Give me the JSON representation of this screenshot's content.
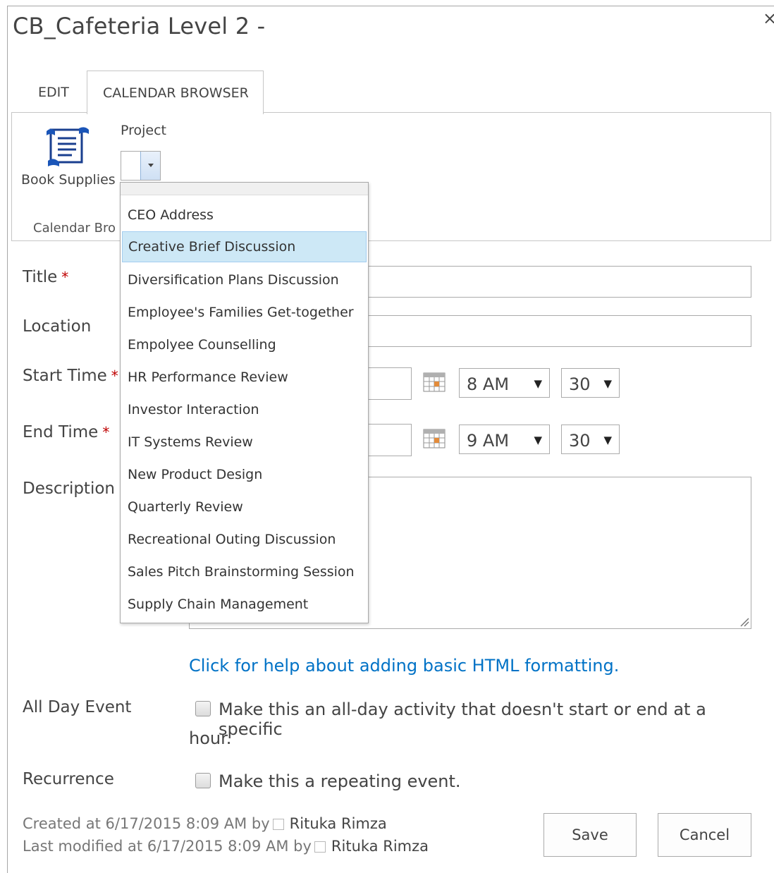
{
  "dialog": {
    "title": "CB_Cafeteria Level 2 -",
    "close_glyph": "×"
  },
  "ribbon": {
    "tabs": [
      {
        "label": "EDIT"
      },
      {
        "label": "CALENDAR BROWSER"
      }
    ],
    "book_supplies_label": "Book Supplies",
    "project_label": "Project",
    "project_value": "",
    "group_label": "Calendar Bro"
  },
  "form": {
    "title_label": "Title",
    "location_label": "Location",
    "start_time_label": "Start Time",
    "end_time_label": "End Time",
    "description_label": "Description",
    "required_marker": "*",
    "start_hour": "8 AM",
    "start_minute": "30",
    "end_hour": "9 AM",
    "end_minute": "30",
    "help_link": "Click for help about adding basic HTML formatting.",
    "all_day_label": "All Day Event",
    "all_day_text_line1": "Make this an all-day activity that doesn't start or end at a specific",
    "all_day_text_line2": "hour.",
    "recurrence_label": "Recurrence",
    "recurrence_text": "Make this a repeating event."
  },
  "footer": {
    "created_prefix": "Created at 6/17/2015 8:09 AM by",
    "created_user": "Rituka Rimza",
    "modified_prefix": "Last modified at 6/17/2015 8:09 AM by",
    "modified_user": "Rituka Rimza",
    "save_label": "Save",
    "cancel_label": "Cancel"
  },
  "project_dropdown": {
    "highlighted": "Creative Brief Discussion",
    "options": [
      "CEO Address",
      "Creative Brief Discussion",
      "Diversification Plans Discussion",
      "Employee's Families Get-together",
      "Empolyee Counselling",
      "HR Performance Review",
      "Investor Interaction",
      "IT Systems Review",
      "New Product Design",
      "Quarterly Review",
      "Recreational Outing Discussion",
      "Sales Pitch Brainstorming Session",
      "Supply Chain Management"
    ]
  },
  "colors": {
    "link": "#0072c6",
    "highlight": "#cde8f6",
    "required": "#bf0000"
  },
  "icons": [
    "close-icon",
    "book-supplies-icon",
    "dropdown-arrow-icon",
    "calendar-icon",
    "resize-grip-icon"
  ]
}
